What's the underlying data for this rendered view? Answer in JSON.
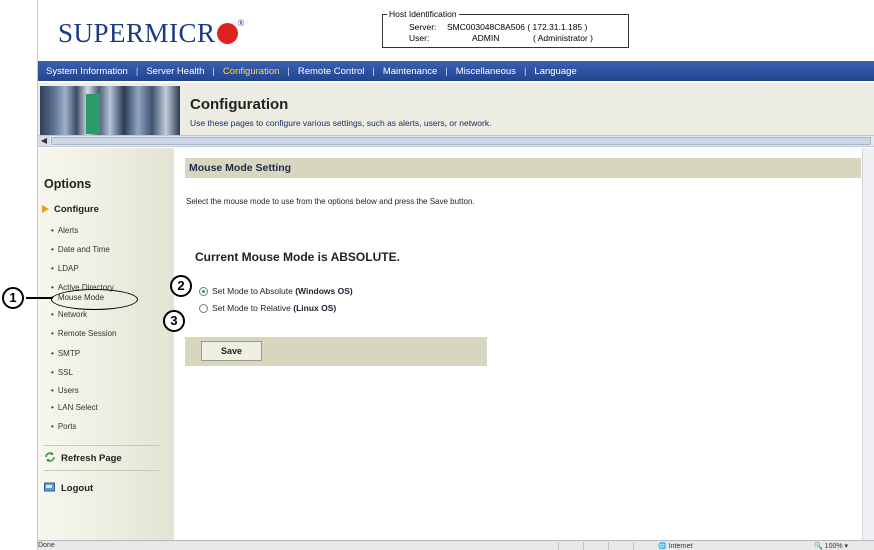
{
  "logo": {
    "text": "SUPERMICR",
    "reg": "®",
    "color": "#1b3a83",
    "dot_color": "#e0201b"
  },
  "host": {
    "legend": "Host Identification",
    "server_label": "Server:",
    "server_value": "SMC003048C8A506 ( 172.31.1.185 )",
    "user_label": "User:",
    "user_name": "ADMIN",
    "user_role": "( Administrator )"
  },
  "nav": {
    "items": [
      "System Information",
      "Server Health",
      "Configuration",
      "Remote Control",
      "Maintenance",
      "Miscellaneous",
      "Language"
    ],
    "active": "Configuration",
    "active_color": "#ffd640"
  },
  "banner": {
    "title": "Configuration",
    "subtitle": "Use these pages to configure various settings, such as alerts, users, or network."
  },
  "sidebar": {
    "heading": "Options",
    "configure": "Configure",
    "items": [
      "Alerts",
      "Date and Time",
      "LDAP",
      "Active Directory",
      "Mouse Mode",
      "Network",
      "Remote Session",
      "SMTP",
      "SSL",
      "Users",
      "LAN Select",
      "Ports"
    ],
    "refresh": "Refresh Page",
    "logout": "Logout"
  },
  "content": {
    "section_title": "Mouse Mode Setting",
    "instructions": "Select the mouse mode to use from the options below and press the Save button.",
    "current_mode": "Current Mouse Mode is ABSOLUTE.",
    "option_absolute_prefix": "Set Mode to Absolute",
    "option_absolute_bold": "(Windows OS)",
    "option_relative_prefix": "Set Mode to Relative",
    "option_relative_bold": "(Linux OS)",
    "selected": "absolute",
    "save_label": "Save"
  },
  "callouts": [
    "1",
    "2",
    "3"
  ],
  "status": {
    "left": "Done",
    "zone": "Internet",
    "zoom": "100%"
  }
}
